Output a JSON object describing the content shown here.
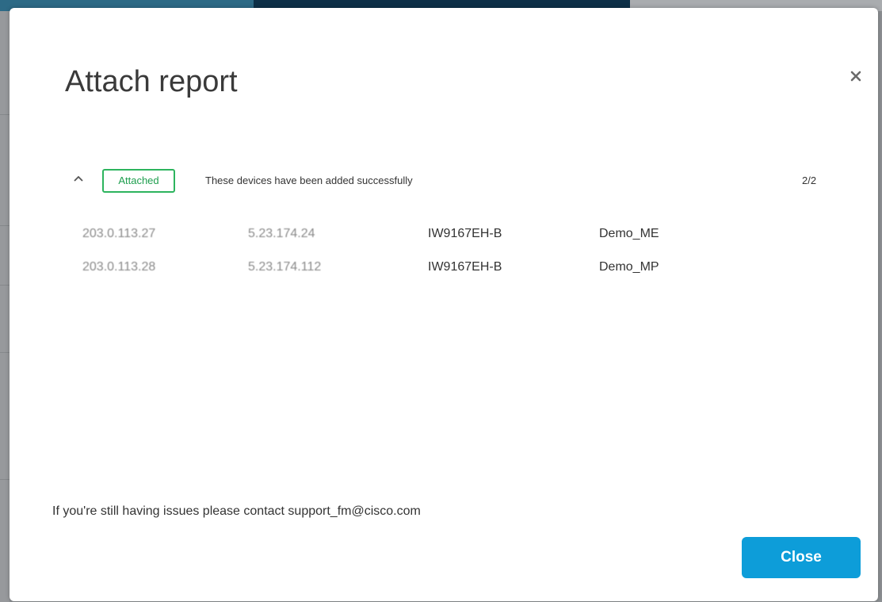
{
  "modal": {
    "title": "Attach report",
    "close_icon": "close-icon"
  },
  "status": {
    "collapse_icon": "chevron-up-icon",
    "badge": "Attached",
    "badge_color": "#2db45e",
    "message": "These devices have been added successfully",
    "count": "2/2"
  },
  "devices": [
    {
      "ip": "203.0.113.27",
      "serial": "5.23.174.24",
      "model": "IW9167EH-B",
      "name": "Demo_ME"
    },
    {
      "ip": "203.0.113.28",
      "serial": "5.23.174.112",
      "model": "IW9167EH-B",
      "name": "Demo_MP"
    }
  ],
  "footer": {
    "support_text": "If you're still having issues please contact support_fm@cisco.com",
    "close_button": "Close",
    "accent_color": "#0d9dd9"
  }
}
